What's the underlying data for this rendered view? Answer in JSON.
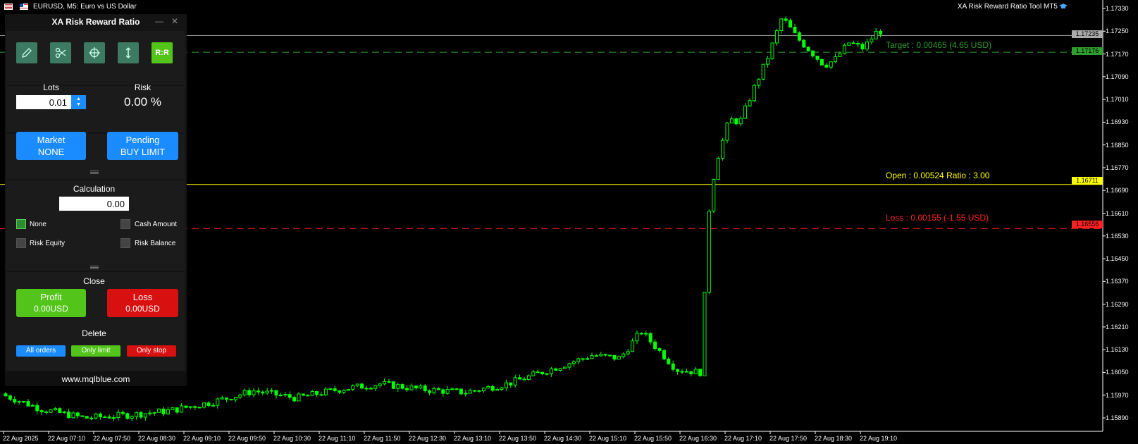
{
  "title_bar": {
    "symbol": "EURUSD, M5:  Euro vs US Dollar",
    "indicator": "XA Risk Reward Ratio Tool MT5"
  },
  "panel": {
    "title": "XA Risk Reward Ratio",
    "minimize": "—",
    "close": "✕",
    "tools": [
      {
        "name": "pencil-icon"
      },
      {
        "name": "scissors-icon"
      },
      {
        "name": "crosshair-icon"
      },
      {
        "name": "vertical-arrow-icon"
      },
      {
        "name": "rr-icon",
        "label": "R:R"
      }
    ],
    "lots_label": "Lots",
    "lots_value": "0.01",
    "risk_label": "Risk",
    "risk_value": "0.00 %",
    "market_label": "Market",
    "market_value": "NONE",
    "pending_label": "Pending",
    "pending_value": "BUY LIMIT",
    "calculation_label": "Calculation",
    "calculation_value": "0.00",
    "options": [
      {
        "label": "None",
        "checked": true
      },
      {
        "label": "Cash Amount",
        "checked": false
      },
      {
        "label": "Risk Equity",
        "checked": false
      },
      {
        "label": "Risk Balance",
        "checked": false
      }
    ],
    "close_label": "Close",
    "profit_label": "Profit",
    "profit_value": "0.00USD",
    "loss_label": "Loss",
    "loss_value": "0.00USD",
    "delete_label": "Delete",
    "delete_buttons": {
      "all": "All orders",
      "limit": "Only limit",
      "stop": "Only stop"
    },
    "footer": "www.mqlblue.com"
  },
  "chart": {
    "price_ticks": [
      "1.17330",
      "1.17250",
      "1.17170",
      "1.17090",
      "1.17010",
      "1.16930",
      "1.16850",
      "1.16770",
      "1.16690",
      "1.16610",
      "1.16530",
      "1.16450",
      "1.16370",
      "1.16290",
      "1.16210",
      "1.16130",
      "1.16050",
      "1.15970",
      "1.15890"
    ],
    "time_ticks": [
      "22 Aug 2025",
      "22 Aug 07:10",
      "22 Aug 07:50",
      "22 Aug 08:30",
      "22 Aug 09:10",
      "22 Aug 09:50",
      "22 Aug 10:30",
      "22 Aug 11:10",
      "22 Aug 11:50",
      "22 Aug 12:30",
      "22 Aug 13:10",
      "22 Aug 13:50",
      "22 Aug 14:30",
      "22 Aug 15:10",
      "22 Aug 15:50",
      "22 Aug 16:30",
      "22 Aug 17:10",
      "22 Aug 17:50",
      "22 Aug 18:30",
      "22 Aug 19:10"
    ],
    "lines": {
      "target": {
        "label": "Target : 0.00465 (4.65 USD)",
        "price_tag": "1.17176",
        "price": 1.17176,
        "color": "#2e9e2e"
      },
      "open": {
        "label": "Open : 0.00524   Ratio : 3.00",
        "price_tag": "1.16711",
        "price": 1.16711,
        "color": "#ffff00"
      },
      "loss": {
        "label": "Loss : 0.00155 (-1.55 USD)",
        "price_tag": "1.16556",
        "price": 1.16556,
        "color": "#ff2020"
      },
      "current": {
        "price_tag": "1.17235",
        "price": 1.17235,
        "color": "#aaaaaa"
      }
    },
    "colors": {
      "candle": "#00ff00",
      "bid_line": "#aaaaaa",
      "accent_blue": "#1a8cff",
      "accent_green": "#52c41a",
      "accent_red": "#d81010"
    }
  }
}
